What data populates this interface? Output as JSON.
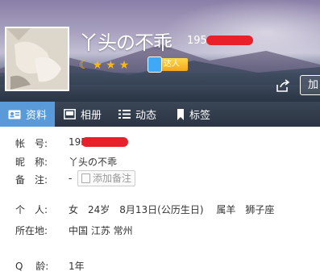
{
  "profile": {
    "nickname": "丫头の不乖",
    "qq_number_prefix": "195",
    "badge_text": "达人",
    "add_button_label": "加"
  },
  "tabs": [
    {
      "label": "资料"
    },
    {
      "label": "相册"
    },
    {
      "label": "动态"
    },
    {
      "label": "标签"
    }
  ],
  "info": {
    "account_label": "帐　号:",
    "account_value": "195",
    "nick_label": "昵　称:",
    "nick_value": "丫头の不乖",
    "remark_label": "备　注:",
    "remark_value": "-",
    "remark_button": "添加备注",
    "person_label": "个　人:",
    "person_value": "女　24岁　8月13日(公历生日)　 属羊　狮子座",
    "location_label": "所在地:",
    "location_value": "中国 江苏 常州",
    "qage_label": "Q　 龄:",
    "qage_value": "1年"
  },
  "colors": {
    "accent_tab": "#5b9ad8",
    "tabbar": "#2f3947",
    "redact": "#e8202a",
    "star": "#f7b71d"
  },
  "icons": [
    "moon-icon",
    "star-icon",
    "vip-face-icon",
    "share-icon",
    "profile-card-icon",
    "album-icon",
    "feed-icon",
    "bookmark-icon",
    "edit-icon"
  ]
}
